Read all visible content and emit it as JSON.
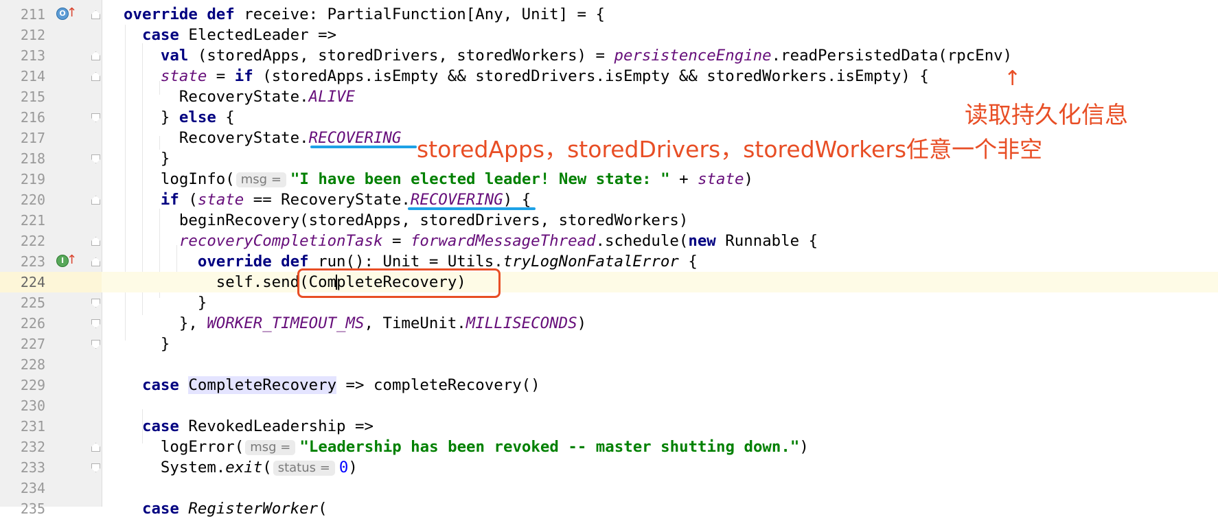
{
  "lines": [
    {
      "n": "211"
    },
    {
      "n": "212"
    },
    {
      "n": "213"
    },
    {
      "n": "214"
    },
    {
      "n": "215"
    },
    {
      "n": "216"
    },
    {
      "n": "217"
    },
    {
      "n": "218"
    },
    {
      "n": "219"
    },
    {
      "n": "220"
    },
    {
      "n": "221"
    },
    {
      "n": "222"
    },
    {
      "n": "223"
    },
    {
      "n": "224"
    },
    {
      "n": "225"
    },
    {
      "n": "226"
    },
    {
      "n": "227"
    },
    {
      "n": "228"
    },
    {
      "n": "229"
    },
    {
      "n": "230"
    },
    {
      "n": "231"
    },
    {
      "n": "232"
    },
    {
      "n": "233"
    },
    {
      "n": "234"
    },
    {
      "n": "235"
    }
  ],
  "hints": {
    "msg": "msg =",
    "status": "status ="
  },
  "annotations": {
    "read_persisted": "读取持久化信息",
    "any_nonempty": "storedApps，storedDrivers，storedWorkers任意一个非空"
  },
  "colors": {
    "annotation": "#e84e25",
    "underline": "#1da1e6",
    "keyword": "#000080",
    "purple": "#660e7a",
    "string": "#008000"
  }
}
